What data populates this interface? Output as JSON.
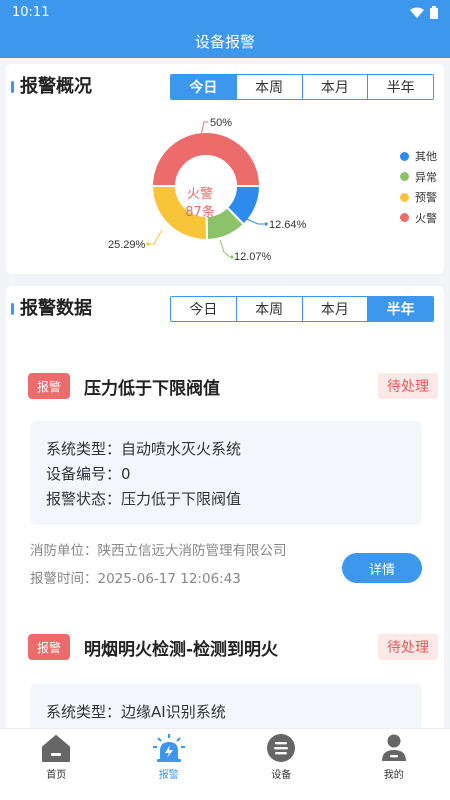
{
  "statusbar": {
    "time": "10:11"
  },
  "appbar": {
    "title": "设备报警"
  },
  "overview": {
    "title": "报警概况",
    "tabs": [
      "今日",
      "本周",
      "本月",
      "半年"
    ],
    "active_tab": 0,
    "center_label": "火警",
    "center_count": "87条",
    "labels": {
      "fire": "50%",
      "warning": "25.29%",
      "abnormal": "12.07%",
      "other": "12.64%"
    },
    "legend": [
      {
        "name": "其他",
        "color": "#2d8ceb"
      },
      {
        "name": "异常",
        "color": "#8cc269"
      },
      {
        "name": "预警",
        "color": "#f8c53a"
      },
      {
        "name": "火警",
        "color": "#ec6b6b"
      }
    ]
  },
  "chart_data": {
    "type": "pie",
    "categories": [
      "火警",
      "其他",
      "异常",
      "预警"
    ],
    "values": [
      50,
      12.64,
      12.07,
      25.29
    ],
    "colors": [
      "#ec6b6b",
      "#2d8ceb",
      "#8cc269",
      "#f8c53a"
    ],
    "legend_position": "right"
  },
  "data_section": {
    "title": "报警数据",
    "tabs": [
      "今日",
      "本周",
      "本月",
      "半年"
    ],
    "active_tab": 3,
    "field_labels": {
      "system_type": "系统类型：",
      "device_no": "设备编号：",
      "alarm_status": "报警状态：",
      "unit": "消防单位：",
      "time": "报警时间："
    },
    "items": [
      {
        "badge": "报警",
        "title": "压力低于下限阀值",
        "status": "待处理",
        "system_type": "自动喷水灭火系统",
        "device_no": "0",
        "alarm_status": "压力低于下限阀值",
        "unit": "陕西立信远大消防管理有限公司",
        "time": "2025-06-17 12:06:43",
        "detail_label": "详情"
      },
      {
        "badge": "报警",
        "title": "明烟明火检测-检测到明火",
        "status": "待处理",
        "system_type": "边缘AI识别系统"
      }
    ]
  },
  "tabbar": {
    "items": [
      {
        "label": "首页",
        "icon": "home-icon"
      },
      {
        "label": "报警",
        "icon": "alarm-light-icon"
      },
      {
        "label": "设备",
        "icon": "device-icon"
      },
      {
        "label": "我的",
        "icon": "user-icon"
      }
    ],
    "active": 1
  }
}
